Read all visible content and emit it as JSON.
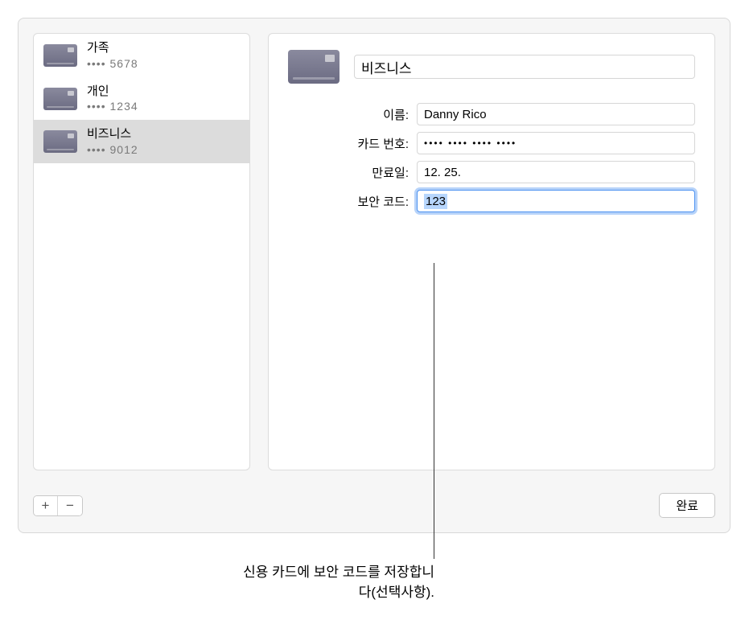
{
  "sidebar": {
    "cards": [
      {
        "name": "가족",
        "last4_display": "•••• 5678"
      },
      {
        "name": "개인",
        "last4_display": "•••• 1234"
      },
      {
        "name": "비즈니스",
        "last4_display": "•••• 9012"
      }
    ]
  },
  "detail": {
    "title": "비즈니스",
    "labels": {
      "name": "이름:",
      "card_number": "카드 번호:",
      "expiry": "만료일:",
      "security": "보안 코드:"
    },
    "values": {
      "name": "Danny Rico",
      "card_number": "•••• •••• •••• ••••",
      "expiry": "12. 25.",
      "security": "123"
    }
  },
  "buttons": {
    "add": "+",
    "remove": "−",
    "done": "완료"
  },
  "callout": {
    "text": "신용 카드에 보안 코드를 저장합니다(선택사항)."
  }
}
